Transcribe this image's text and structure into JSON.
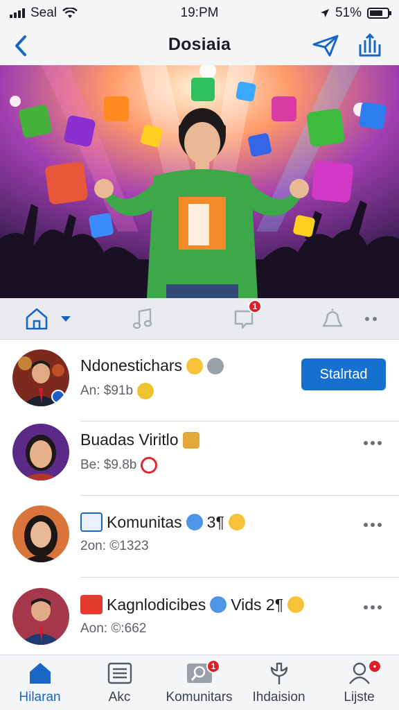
{
  "status_bar": {
    "carrier": "Seal",
    "time": "19:PM",
    "battery": "51%"
  },
  "header": {
    "title": "Dosiaia"
  },
  "hero": {
    "image": "concert-performer-with-floating-app-icons"
  },
  "toolbar": {
    "items": [
      {
        "icon": "home-icon",
        "has_dropdown": true
      },
      {
        "icon": "music-note-icon"
      },
      {
        "icon": "chat-icon",
        "badge": "1"
      },
      {
        "icon": "bell-icon"
      },
      {
        "icon": "more-icon"
      }
    ]
  },
  "list": [
    {
      "name": "Ndonestichars",
      "subtitle": "An: $91b",
      "action": "Stalrtad",
      "emojis": [
        "grin-emoji",
        "mic-emoji"
      ],
      "sub_icon": "chart-emoji"
    },
    {
      "name": "Buadas Viritlo",
      "subtitle": "Be: $9.8b",
      "emojis": [
        "box-emoji"
      ],
      "sub_icon": "no-emoji"
    },
    {
      "name": "Komunitas",
      "suffix": "3¶",
      "subtitle": "2on: ©1323",
      "emojis": [
        "snowflake-emoji",
        "grin-emoji"
      ]
    },
    {
      "name": "Kagnlodicibes",
      "suffix": "Vids 2¶",
      "subtitle": "Aon: ©:662",
      "emojis": [
        "snowflake-emoji",
        "grin-emoji"
      ]
    }
  ],
  "tabs": [
    {
      "label": "Hilaran",
      "icon": "home-icon",
      "active": true
    },
    {
      "label": "Akc",
      "icon": "list-icon"
    },
    {
      "label": "Komunitars",
      "icon": "community-search-icon",
      "badge": "1"
    },
    {
      "label": "Ihdaision",
      "icon": "hand-icon"
    },
    {
      "label": "Lijste",
      "icon": "profile-icon",
      "badge": "•"
    }
  ],
  "colors": {
    "accent": "#1670d0",
    "badge": "#e11d2a",
    "tab_active": "#1a66c4"
  }
}
